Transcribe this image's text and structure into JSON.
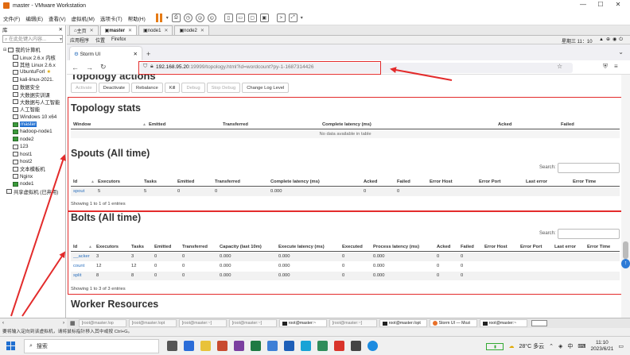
{
  "window": {
    "title": "master - VMware Workstation",
    "controls": [
      "—",
      "☐",
      "✕"
    ]
  },
  "menu": [
    "文件(F)",
    "编辑(E)",
    "查看(V)",
    "虚拟机(M)",
    "选项卡(T)",
    "帮助(H)"
  ],
  "library": {
    "header": "库",
    "close": "✕",
    "search_placeholder": "在此处键入内容...",
    "root": "我的计算机",
    "items": [
      "Linux 2.6.x 内核",
      "其他 Linux 2.6.x",
      "UbuntuForI",
      "kali-linux-2021.",
      "数据安全",
      "大数据实训课",
      "大数据与人工智能",
      "人工智能",
      "Windows 10 x64",
      "master",
      "hadoop-node1",
      "node2",
      "123",
      "host1",
      "host2",
      "文本模板机",
      "Nginx",
      "node1"
    ],
    "shared": "共享虚拟机 (已弃用)",
    "selected": "master"
  },
  "vm_tabs": [
    {
      "label": "主页",
      "active": false
    },
    {
      "label": "master",
      "active": true
    },
    {
      "label": "node1",
      "active": false
    },
    {
      "label": "node2",
      "active": false
    }
  ],
  "guest_bar": {
    "menus": [
      "应用程序",
      "位置",
      "Firefox"
    ],
    "clock": "星期三 11：10"
  },
  "browser": {
    "tab_title": "Storm UI",
    "url_host": "192.168.95.20",
    "url_rest": ":19999/topology.html?id=wordcount?py-1-1687314426"
  },
  "page": {
    "cut_title": "Topology actions",
    "actions": [
      {
        "label": "Activate",
        "enabled": false
      },
      {
        "label": "Deactivate",
        "enabled": true
      },
      {
        "label": "Rebalance",
        "enabled": true
      },
      {
        "label": "Kill",
        "enabled": true
      },
      {
        "label": "Debug",
        "enabled": false
      },
      {
        "label": "Stop Debug",
        "enabled": false
      },
      {
        "label": "Change Log Level",
        "enabled": true
      }
    ],
    "topology_stats": {
      "title": "Topology stats",
      "columns": [
        "Window",
        "Emitted",
        "Transferred",
        "Complete latency (ms)",
        "Acked",
        "Failed"
      ],
      "empty": "No data available in table"
    },
    "spouts": {
      "title": "Spouts (All time)",
      "search_label": "Search:",
      "columns": [
        "Id",
        "Executors",
        "Tasks",
        "Emitted",
        "Transferred",
        "Complete latency (ms)",
        "Acked",
        "Failed",
        "Error Host",
        "Error Port",
        "Last error",
        "Error Time"
      ],
      "rows": [
        [
          "spout",
          "5",
          "5",
          "0",
          "0",
          "0.000",
          "0",
          "0",
          "",
          "",
          "",
          ""
        ]
      ],
      "info": "Showing 1 to 1 of 1 entries"
    },
    "bolts": {
      "title": "Bolts (All time)",
      "search_label": "Search:",
      "columns": [
        "Id",
        "Executors",
        "Tasks",
        "Emitted",
        "Transferred",
        "Capacity (last 10m)",
        "Execute latency (ms)",
        "Executed",
        "Process latency (ms)",
        "Acked",
        "Failed",
        "Error Host",
        "Error Port",
        "Last error",
        "Error Time"
      ],
      "rows": [
        [
          "__acker",
          "3",
          "3",
          "0",
          "0",
          "0.000",
          "0.000",
          "0",
          "0.000",
          "0",
          "0",
          "",
          "",
          "",
          ""
        ],
        [
          "count",
          "12",
          "12",
          "0",
          "0",
          "0.000",
          "0.000",
          "0",
          "0.000",
          "0",
          "0",
          "",
          "",
          "",
          ""
        ],
        [
          "split",
          "8",
          "8",
          "0",
          "0",
          "0.000",
          "0.000",
          "0",
          "0.000",
          "0",
          "0",
          "",
          "",
          "",
          ""
        ]
      ],
      "info": "Showing 1 to 3 of 3 entries"
    },
    "worker_title": "Worker Resources"
  },
  "vm_taskbar": [
    {
      "label": "[root@master:/op",
      "kind": "dim"
    },
    {
      "label": "[root@master:/opt",
      "kind": "dim"
    },
    {
      "label": "[root@master:~]",
      "kind": "dim"
    },
    {
      "label": "[root@master:~]",
      "kind": "dim"
    },
    {
      "label": "root@master:~",
      "kind": "term"
    },
    {
      "label": "[root@master:~]",
      "kind": "dim"
    },
    {
      "label": "root@master:/opt",
      "kind": "term"
    },
    {
      "label": "Storm UI — Mozi",
      "kind": "ff"
    },
    {
      "label": "root@master:~",
      "kind": "term"
    }
  ],
  "hint": "要将输入定向到该虚拟机，请将鼠标指针移入其中或按 Ctrl+G。",
  "taskbar": {
    "search_placeholder": "搜索",
    "weather": "28°C 多云",
    "ime": "中",
    "time": "11:10",
    "date": "2023/6/21"
  },
  "colors": {
    "highlight": "#e32b2b",
    "link": "#2a6fbd",
    "selection": "#1f6fd1"
  }
}
